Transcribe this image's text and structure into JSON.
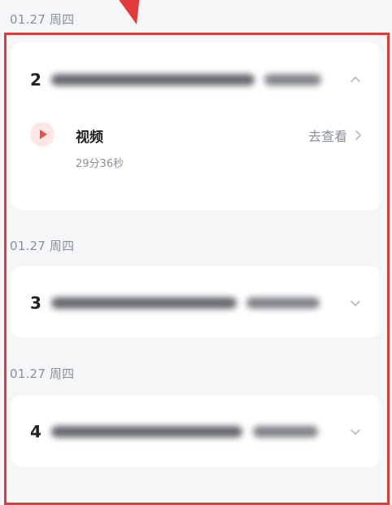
{
  "sections": [
    {
      "date": "01.27 周四",
      "lesson": {
        "number": "2",
        "expanded": true,
        "items": [
          {
            "title": "视频",
            "duration": "29分36秒",
            "action_label": "去查看"
          }
        ]
      }
    },
    {
      "date": "01.27 周四",
      "lesson": {
        "number": "3",
        "expanded": false
      }
    },
    {
      "date": "01.27 周四",
      "lesson": {
        "number": "4",
        "expanded": false
      }
    }
  ],
  "colors": {
    "accent_red": "#e23b3b",
    "play_icon": "#f0504a",
    "play_icon_bg": "#fde7e5",
    "muted_text": "#8a8f98"
  },
  "icons": {
    "play": "play-icon",
    "chevron_up": "chevron-up-icon",
    "chevron_down": "chevron-down-icon",
    "chevron_right": "chevron-right-icon"
  }
}
